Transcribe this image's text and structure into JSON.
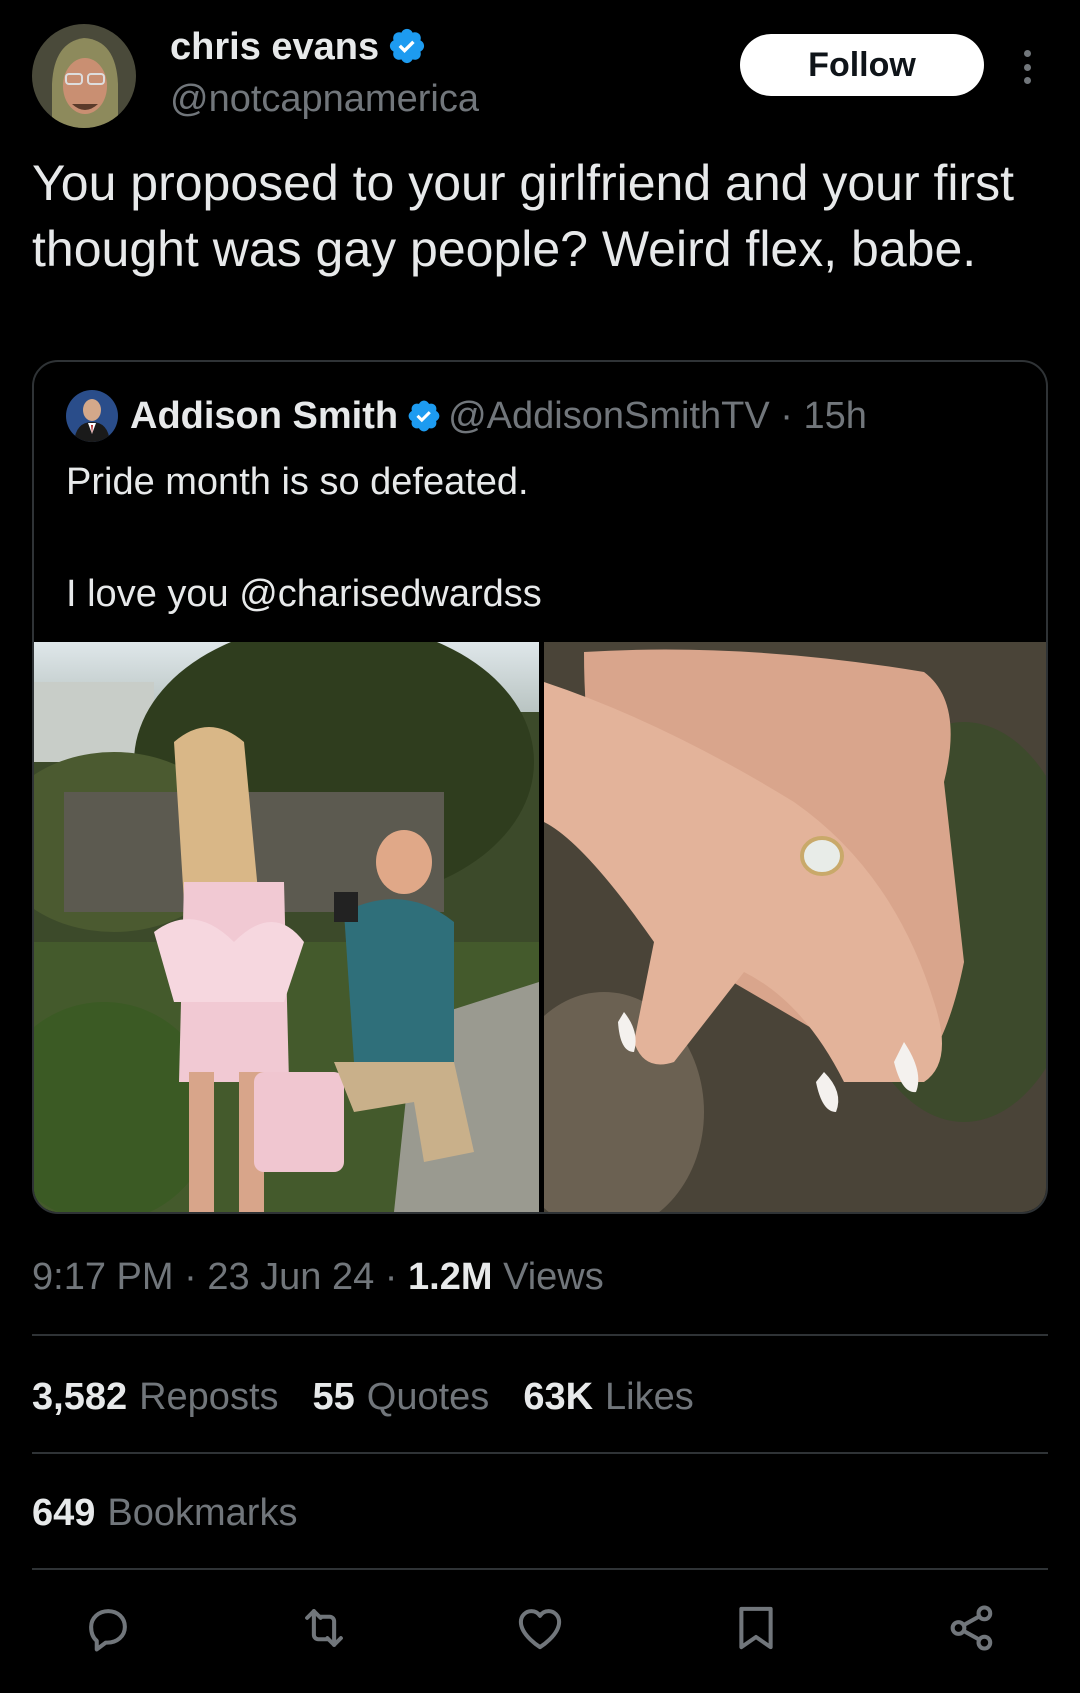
{
  "author": {
    "display_name": "chris evans",
    "handle": "@notcapnamerica",
    "verified_icon": "verified-badge-icon"
  },
  "header": {
    "follow_label": "Follow",
    "more_icon": "more-options-icon"
  },
  "tweet": {
    "text": "You proposed to your girlfriend and your first thought was gay people? Weird flex, babe."
  },
  "quote": {
    "display_name": "Addison Smith",
    "handle": "@AddisonSmithTV",
    "separator": "·",
    "age": "15h",
    "text": "Pride month is so defeated.\n\nI love you @charisedwardss"
  },
  "meta": {
    "time": "9:17 PM",
    "sep1": "·",
    "date": "23 Jun 24",
    "sep2": "·",
    "views_count": "1.2M",
    "views_label": "Views"
  },
  "stats": {
    "reposts_count": "3,582",
    "reposts_label": "Reposts",
    "quotes_count": "55",
    "quotes_label": "Quotes",
    "likes_count": "63K",
    "likes_label": "Likes",
    "bookmarks_count": "649",
    "bookmarks_label": "Bookmarks"
  },
  "actions": [
    "reply-icon",
    "repost-icon",
    "like-icon",
    "bookmark-icon",
    "share-icon"
  ],
  "colors": {
    "background": "#000000",
    "text_primary": "#e7e9ea",
    "text_secondary": "#71767b",
    "verified_blue": "#1d9bf0",
    "divider": "#2f3336"
  }
}
